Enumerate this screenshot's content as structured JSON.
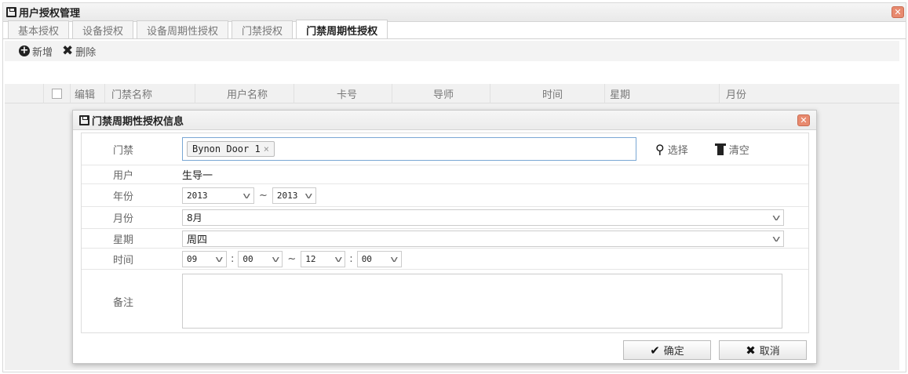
{
  "panel": {
    "title": "用户授权管理"
  },
  "tabs": [
    {
      "label": "基本授权"
    },
    {
      "label": "设备授权"
    },
    {
      "label": "设备周期性授权"
    },
    {
      "label": "门禁授权"
    },
    {
      "label": "门禁周期性授权"
    }
  ],
  "toolbar": {
    "add": "新增",
    "delete": "删除"
  },
  "grid": {
    "columns": [
      "编辑",
      "门禁名称",
      "用户名称",
      "卡号",
      "导师",
      "时间",
      "星期",
      "月份"
    ]
  },
  "dialog": {
    "title": "门禁周期性授权信息",
    "door": {
      "label": "门禁",
      "token": "Bynon Door 1",
      "select": "选择",
      "clear": "清空"
    },
    "user": {
      "label": "用户",
      "value": "生导一"
    },
    "year": {
      "label": "年份",
      "from": "2013",
      "to": "2013",
      "sep": "~"
    },
    "month": {
      "label": "月份",
      "value": "8月"
    },
    "week": {
      "label": "星期",
      "value": "周四"
    },
    "time": {
      "label": "时间",
      "h1": "09",
      "m1": "00",
      "h2": "12",
      "m2": "00",
      "sep": "~",
      "colon": ":"
    },
    "note": {
      "label": "备注"
    },
    "ok": "确定",
    "cancel": "取消"
  },
  "colors": {
    "close": "#e88a6f",
    "focus_border": "#7aa7d4"
  }
}
